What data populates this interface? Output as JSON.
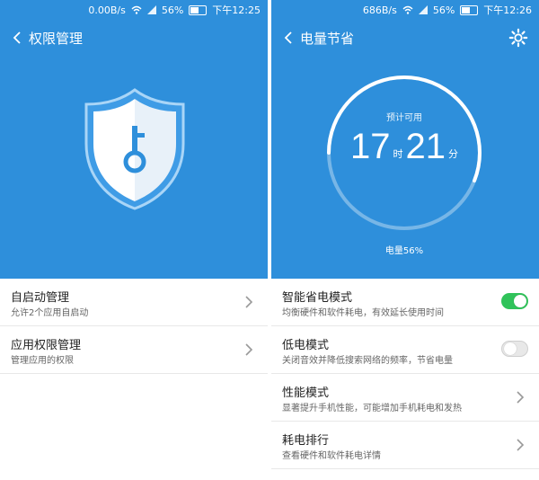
{
  "left": {
    "status": {
      "net": "0.00B/s",
      "battery": "56%",
      "time": "下午12:25"
    },
    "header": {
      "title": "权限管理"
    },
    "items": [
      {
        "title": "自启动管理",
        "subtitle": "允许2个应用自启动"
      },
      {
        "title": "应用权限管理",
        "subtitle": "管理应用的权限"
      }
    ],
    "colors": {
      "accent": "#2e8fdb"
    }
  },
  "right": {
    "status": {
      "net": "686B/s",
      "battery": "56%",
      "time": "下午12:26"
    },
    "header": {
      "title": "电量节省"
    },
    "gauge": {
      "label": "预计可用",
      "hours": "17",
      "hour_unit": "时",
      "minutes": "21",
      "minute_unit": "分",
      "battery_text": "电量56%",
      "battery_fraction": 0.56
    },
    "items": [
      {
        "title": "智能省电模式",
        "subtitle": "均衡硬件和软件耗电，有效延长使用时间",
        "toggle": "on"
      },
      {
        "title": "低电模式",
        "subtitle": "关闭音效并降低搜索网络的频率，节省电量",
        "toggle": "off"
      },
      {
        "title": "性能模式",
        "subtitle": "显著提升手机性能，可能增加手机耗电和发热"
      },
      {
        "title": "耗电排行",
        "subtitle": "查看硬件和软件耗电详情"
      }
    ],
    "colors": {
      "accent": "#2e8fdb",
      "toggle_on": "#30c35a"
    }
  }
}
